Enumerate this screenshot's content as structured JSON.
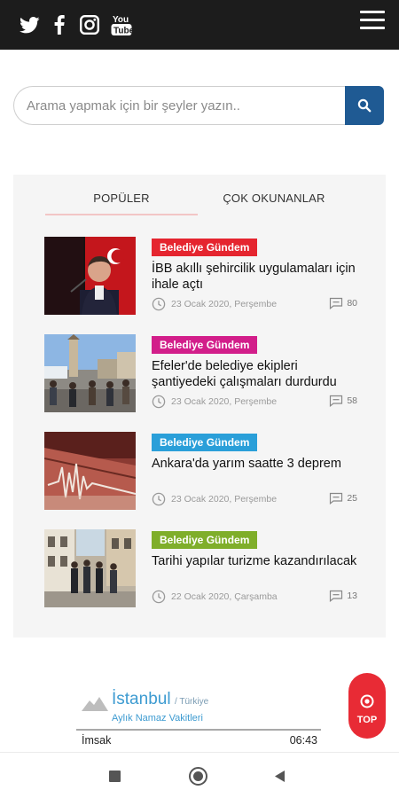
{
  "header": {
    "social_icons": [
      "twitter-icon",
      "facebook-icon",
      "instagram-icon",
      "youtube-icon"
    ],
    "menu_icon": "hamburger-menu-icon"
  },
  "search": {
    "placeholder": "Arama yapmak için bir şeyler yazın..",
    "button_icon": "search-icon"
  },
  "tabs": [
    {
      "label": "POPÜLER",
      "active": true
    },
    {
      "label": "ÇOK OKUNANLAR",
      "active": false
    }
  ],
  "articles": [
    {
      "category": "Belediye Gündem",
      "category_color": "#e5252f",
      "title": "İBB akıllı şehircilik uygulamaları için ihale açtı",
      "date": "23 Ocak 2020, Perşembe",
      "comments": "80"
    },
    {
      "category": "Belediye Gündem",
      "category_color": "#d21e8a",
      "title": "Efeler'de belediye ekipleri şantiyedeki çalışmaları durdurdu",
      "date": "23 Ocak 2020, Perşembe",
      "comments": "58"
    },
    {
      "category": "Belediye Gündem",
      "category_color": "#2a9fd9",
      "title": "Ankara'da yarım saatte 3 deprem",
      "date": "23 Ocak 2020, Perşembe",
      "comments": "25"
    },
    {
      "category": "Belediye Gündem",
      "category_color": "#7fae2a",
      "title": "Tarihi yapılar turizme kazandırılacak",
      "date": "22 Ocak 2020, Çarşamba",
      "comments": "13"
    }
  ],
  "prayer": {
    "city": "İstanbul",
    "country": "/ Türkiye",
    "subtitle": "Aylık Namaz Vakitleri",
    "row_name": "İmsak",
    "row_time": "06:43"
  },
  "top_button": {
    "label": "TOP"
  },
  "colors": {
    "header_bg": "#1c1c1c",
    "search_button": "#1f5a93",
    "accent_red": "#e82b35",
    "link_blue": "#3d9bd1"
  }
}
